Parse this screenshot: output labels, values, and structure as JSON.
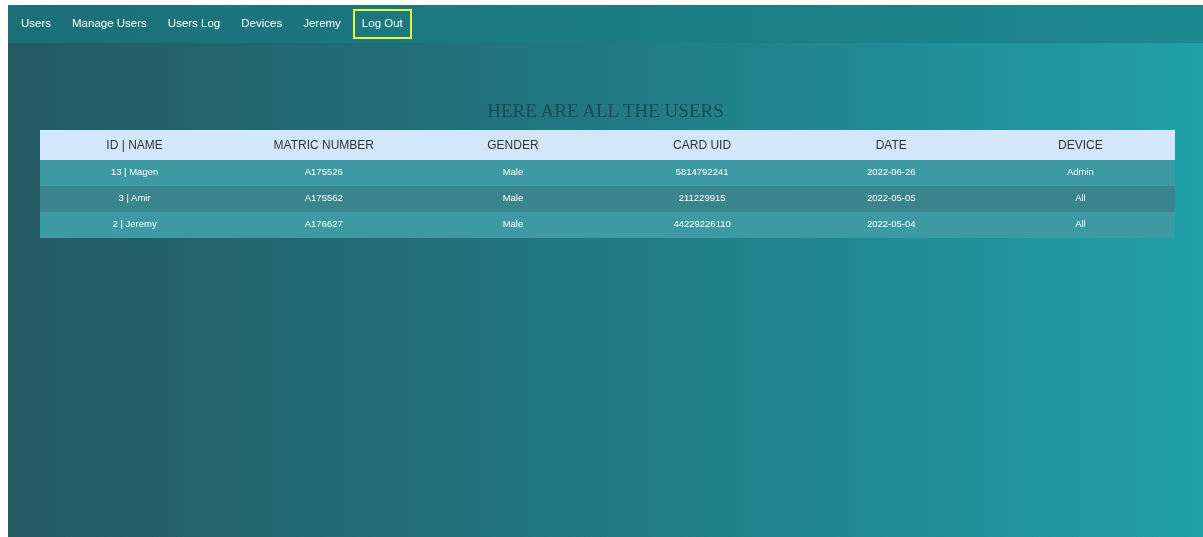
{
  "nav": [
    {
      "label": "Users",
      "highlighted": false
    },
    {
      "label": "Manage Users",
      "highlighted": false
    },
    {
      "label": "Users Log",
      "highlighted": false
    },
    {
      "label": "Devices",
      "highlighted": false
    },
    {
      "label": "Jeremy",
      "highlighted": false
    },
    {
      "label": "Log Out",
      "highlighted": true
    }
  ],
  "heading": "HERE ARE ALL THE USERS",
  "table": {
    "columns": [
      "ID | NAME",
      "MATRIC NUMBER",
      "GENDER",
      "CARD UID",
      "DATE",
      "DEVICE"
    ],
    "rows": [
      [
        "13 | Magen",
        "A175526",
        "Male",
        "5814792241",
        "2022-06-26",
        "Admin"
      ],
      [
        "3 | Amir",
        "A175562",
        "Male",
        "211229915",
        "2022-05-05",
        "All"
      ],
      [
        "2 | Jeremy",
        "A176627",
        "Male",
        "44229226110",
        "2022-05-04",
        "All"
      ]
    ]
  }
}
